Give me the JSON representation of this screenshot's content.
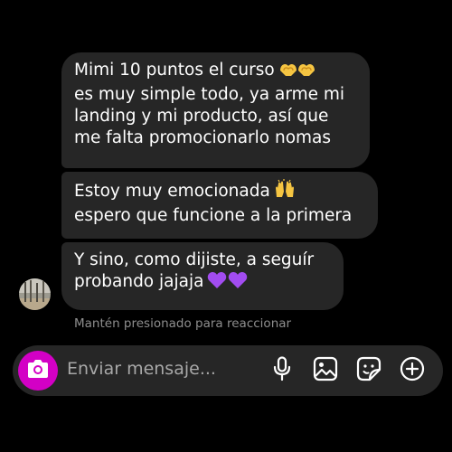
{
  "messages": [
    {
      "lines": [
        "Mimi 10 puntos el curso",
        "es muy simple todo, ya arme mi",
        "landing y mi producto, así que",
        "me falta promocionarlo nomas"
      ],
      "emoji": "heart-hands-emoji"
    },
    {
      "lines": [
        "Estoy muy emocionada",
        "espero que funcione a la primera"
      ],
      "emoji": "raising-hands-emoji"
    },
    {
      "lines": [
        "Y sino, como dijiste, a seguír",
        "probando jajaja"
      ],
      "emoji": "purple-hearts-emoji"
    }
  ],
  "reaction_hint": "Mantén presionado para reaccionar",
  "composer": {
    "placeholder": "Enviar mensaje...",
    "icons": [
      "camera-icon",
      "microphone-icon",
      "gallery-icon",
      "sticker-icon",
      "plus-circle-icon"
    ]
  },
  "colors": {
    "background": "#000000",
    "bubble": "#262626",
    "camera_button": "#d300c5",
    "hint": "#8e8e8e",
    "purple_heart": "#a24cf0"
  }
}
